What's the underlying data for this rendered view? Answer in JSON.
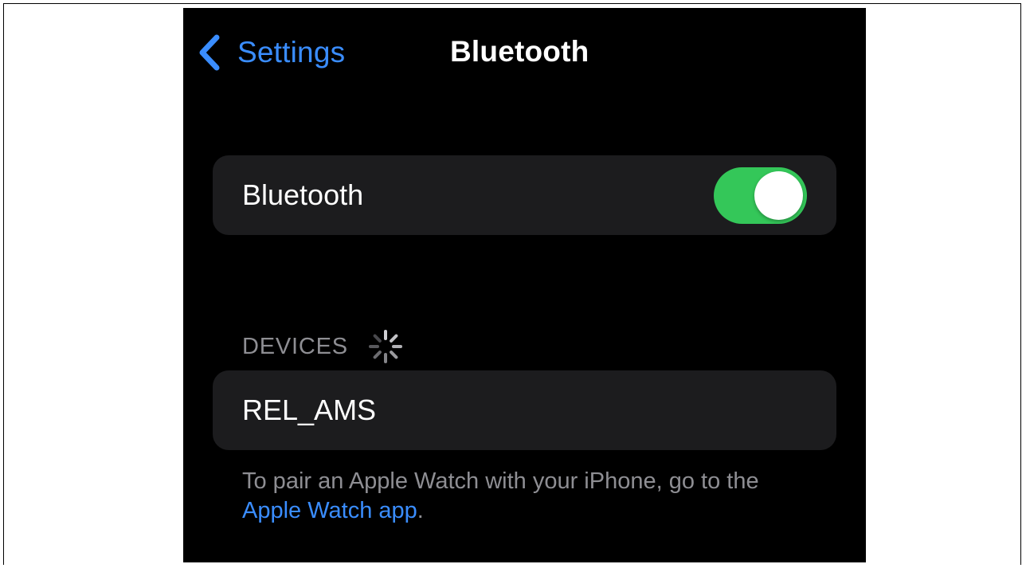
{
  "nav": {
    "back_label": "Settings",
    "title": "Bluetooth"
  },
  "bluetooth_row": {
    "label": "Bluetooth",
    "enabled": true
  },
  "devices": {
    "header": "DEVICES",
    "items": [
      {
        "name": "REL_AMS"
      }
    ]
  },
  "footer": {
    "text_before": "To pair an Apple Watch with your iPhone, go to the ",
    "link_label": "Apple Watch app",
    "text_after": "."
  },
  "icons": {
    "back": "chevron-left-icon",
    "spinner": "activity-spinner-icon"
  },
  "colors": {
    "accent": "#3a8dff",
    "toggle_on": "#34c759",
    "background": "#000000",
    "group_background": "#1c1c1e",
    "secondary_text": "#8e8e93"
  }
}
